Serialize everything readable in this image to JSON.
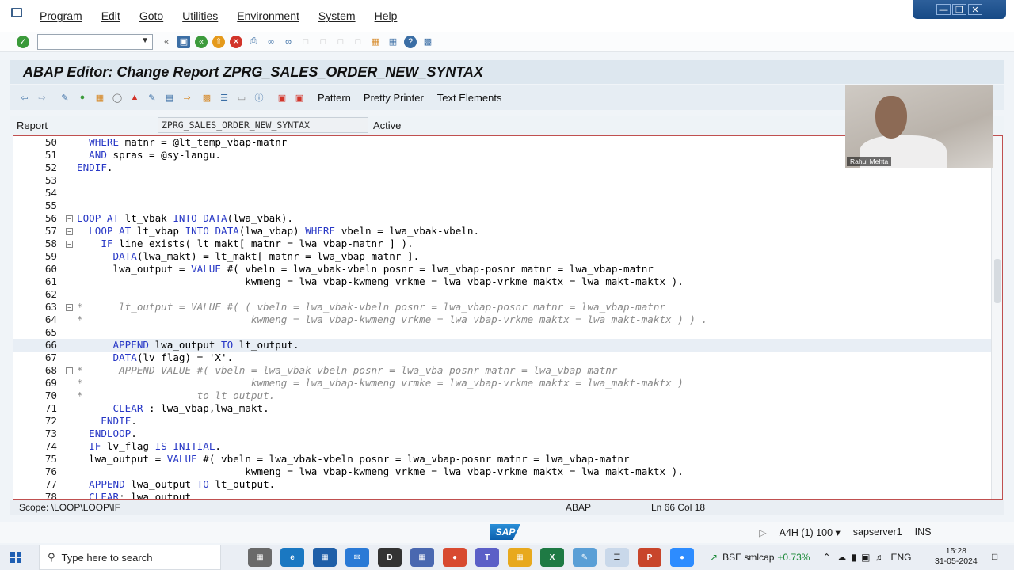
{
  "menu": [
    "Program",
    "Edit",
    "Goto",
    "Utilities",
    "Environment",
    "System",
    "Help"
  ],
  "window_title": "ABAP Editor: Change Report ZPRG_SALES_ORDER_NEW_SYNTAX",
  "app_toolbar": {
    "pattern": "Pattern",
    "pretty_printer": "Pretty Printer",
    "text_elements": "Text Elements"
  },
  "report": {
    "label": "Report",
    "name": "ZPRG_SALES_ORDER_NEW_SYNTAX",
    "status": "Active"
  },
  "code_lines": [
    {
      "n": "50",
      "code": "  WHERE matnr = @lt_temp_vbap-matnr",
      "comment": false
    },
    {
      "n": "51",
      "code": "  AND spras = @sy-langu.",
      "comment": false
    },
    {
      "n": "52",
      "code": "ENDIF.",
      "comment": false
    },
    {
      "n": "53",
      "code": "",
      "comment": false
    },
    {
      "n": "54",
      "code": "",
      "comment": false
    },
    {
      "n": "55",
      "code": "",
      "comment": false
    },
    {
      "n": "56",
      "code": "LOOP AT lt_vbak INTO DATA(lwa_vbak).",
      "comment": false,
      "fold": true
    },
    {
      "n": "57",
      "code": "  LOOP AT lt_vbap INTO DATA(lwa_vbap) WHERE vbeln = lwa_vbak-vbeln.",
      "comment": false,
      "fold": true
    },
    {
      "n": "58",
      "code": "    IF line_exists( lt_makt[ matnr = lwa_vbap-matnr ] ).",
      "comment": false,
      "fold": true
    },
    {
      "n": "59",
      "code": "      DATA(lwa_makt) = lt_makt[ matnr = lwa_vbap-matnr ].",
      "comment": false
    },
    {
      "n": "60",
      "code": "      lwa_output = VALUE #( vbeln = lwa_vbak-vbeln posnr = lwa_vbap-posnr matnr = lwa_vbap-matnr",
      "comment": false
    },
    {
      "n": "61",
      "code": "                            kwmeng = lwa_vbap-kwmeng vrkme = lwa_vbap-vrkme maktx = lwa_makt-maktx ).",
      "comment": false
    },
    {
      "n": "62",
      "code": "",
      "comment": false
    },
    {
      "n": "63",
      "code": "*      lt_output = VALUE #( ( vbeln = lwa_vbak-vbeln posnr = lwa_vbap-posnr matnr = lwa_vbap-matnr",
      "comment": true,
      "fold": true
    },
    {
      "n": "64",
      "code": "*                            kwmeng = lwa_vbap-kwmeng vrkme = lwa_vbap-vrkme maktx = lwa_makt-maktx ) ) .",
      "comment": true
    },
    {
      "n": "65",
      "code": "",
      "comment": false
    },
    {
      "n": "66",
      "code": "      APPEND lwa_output TO lt_output.",
      "comment": false,
      "current": true
    },
    {
      "n": "67",
      "code": "      DATA(lv_flag) = 'X'.",
      "comment": false
    },
    {
      "n": "68",
      "code": "*      APPEND VALUE #( vbeln = lwa_vbak-vbeln posnr = lwa_vba-posnr matnr = lwa_vbap-matnr",
      "comment": true,
      "fold": true
    },
    {
      "n": "69",
      "code": "*                            kwmeng = lwa_vbap-kwmeng vrmke = lwa_vbap-vrkme maktx = lwa_makt-maktx )",
      "comment": true
    },
    {
      "n": "70",
      "code": "*                   to lt_output.",
      "comment": true
    },
    {
      "n": "71",
      "code": "      CLEAR : lwa_vbap,lwa_makt.",
      "comment": false
    },
    {
      "n": "72",
      "code": "    ENDIF.",
      "comment": false
    },
    {
      "n": "73",
      "code": "  ENDLOOP.",
      "comment": false
    },
    {
      "n": "74",
      "code": "  IF lv_flag IS INITIAL.",
      "comment": false
    },
    {
      "n": "75",
      "code": "  lwa_output = VALUE #( vbeln = lwa_vbak-vbeln posnr = lwa_vbap-posnr matnr = lwa_vbap-matnr",
      "comment": false
    },
    {
      "n": "76",
      "code": "                            kwmeng = lwa_vbap-kwmeng vrkme = lwa_vbap-vrkme maktx = lwa_makt-maktx ).",
      "comment": false
    },
    {
      "n": "77",
      "code": "  APPEND lwa_output TO lt_output.",
      "comment": false
    },
    {
      "n": "78",
      "code": "  CLEAR: lwa_output.",
      "comment": false
    }
  ],
  "status_bar": {
    "scope": "Scope: \\LOOP\\LOOP\\IF",
    "language": "ABAP",
    "position": "Ln  66 Col  18"
  },
  "sap_bar": {
    "logo": "SAP",
    "system": "A4H (1) 100",
    "server": "sapserver1",
    "mode": "INS"
  },
  "webcam": {
    "name": "Rahul Mehta"
  },
  "taskbar": {
    "search_placeholder": "Type here to search",
    "ticker_name": "BSE smlcap",
    "ticker_change": "+0.73%",
    "language": "ENG",
    "time": "15:28",
    "date": "31-05-2024"
  },
  "colors": {
    "keyword": "#2838c6",
    "comment": "#8a8a8a",
    "title_bar": "#dde7ef",
    "editor_border": "#c05050"
  }
}
